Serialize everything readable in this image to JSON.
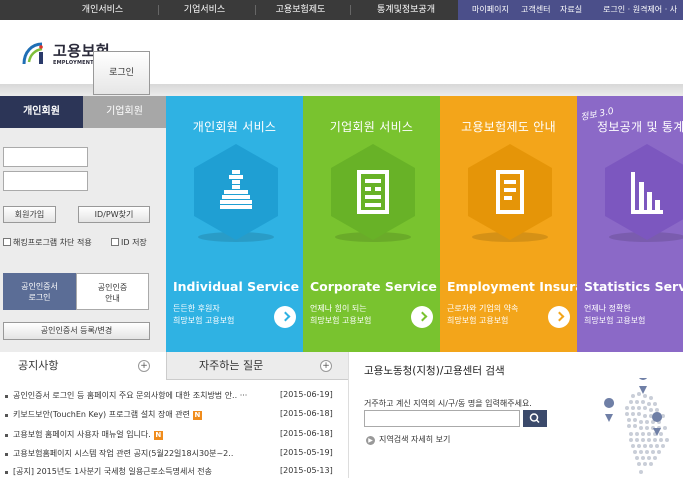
{
  "topnav": {
    "items": [
      "개인서비스",
      "기업서비스",
      "고용보험제도",
      "통계및정보공개"
    ],
    "util": [
      "마이페이지",
      "고객센터",
      "자료실",
      "로그인 · 원격제어 · 사"
    ]
  },
  "logo": {
    "ko": "고용보험",
    "en": "EMPLOYMENT INSURANCE"
  },
  "login": {
    "tabs": [
      "개인회원",
      "기업회원"
    ],
    "login_button": "로그인",
    "join_button": "회원가입",
    "find_button": "ID/PW찾기",
    "check_hacking": "해킹프로그램 차단 적용",
    "check_id": "ID 저장",
    "cert_login": [
      "공인인증서",
      "로그인"
    ],
    "cert_guide": [
      "공인인증",
      "안내"
    ],
    "cert_register": "공인인증서 등록/변경"
  },
  "services": [
    {
      "title": "개인회원 서비스",
      "en": "Individual Service",
      "desc1": "든든한 후원자",
      "desc2": "희망보험 고용보험"
    },
    {
      "title": "기업회원 서비스",
      "en": "Corporate Service",
      "desc1": "언제나 힘이 되는",
      "desc2": "희망보험 고용보험"
    },
    {
      "title": "고용보험제도 안내",
      "en": "Employment Insurance",
      "desc1": "근로자와 기업의 약속",
      "desc2": "희망보험 고용보험"
    },
    {
      "title": "정보공개 및 통계",
      "en": "Statistics Service",
      "desc1": "언제나 정확한",
      "desc2": "희망보험 고용보험"
    }
  ],
  "jeongbo_badge": "정보 3.0",
  "notice": {
    "tab1": "공지사항",
    "tab2": "자주하는 질문",
    "rows": [
      {
        "text": "공인인증서 로그인 등 홈페이지 주요 문의사항에 대한 조치방법 안.. ···",
        "date": "[2015-06-19]",
        "new": false
      },
      {
        "text": "키보드보안(TouchEn Key) 프로그램 설치 장애 관련",
        "date": "[2015-06-18]",
        "new": true
      },
      {
        "text": "고용보험 홈페이지 사용자 매뉴얼 입니다.",
        "date": "[2015-06-18]",
        "new": true
      },
      {
        "text": "고용보험홈페이지 시스템 작업 관련 공지(5월22일18시30분~2..",
        "date": "[2015-05-19]",
        "new": false
      },
      {
        "text": "[공지] 2015년도 1사분기 국세청 일용근로소득명세서 전송",
        "date": "[2015-05-13]",
        "new": false
      }
    ],
    "new_badge": "N"
  },
  "search": {
    "title": "고용노동청(지청)/고용센터 검색",
    "desc": "거주하고 계신 지역의 시/구/동 명을 입력해주세요.",
    "link": "지역검색 자세히 보기"
  },
  "colors": {
    "individual": "#2fb2e3",
    "corporate": "#79c32f",
    "employment": "#f3a51a",
    "statistics": "#8b69c7",
    "nav": "#3a3a3a",
    "util": "#4b4f8a"
  }
}
